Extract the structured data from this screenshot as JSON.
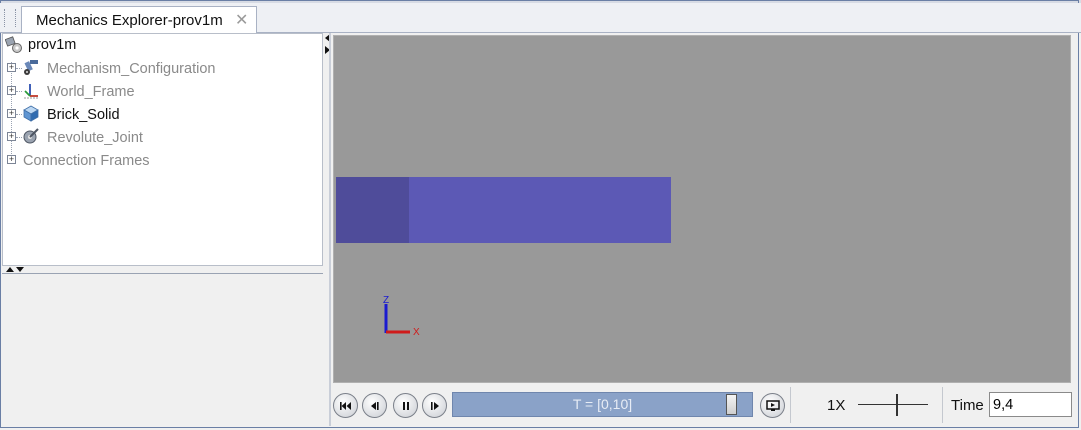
{
  "tab": {
    "title": "Mechanics Explorer-prov1m",
    "close_glyph": "✕"
  },
  "tree": {
    "root": "prov1m",
    "items": [
      {
        "label": "Mechanism_Configuration",
        "icon": "mechanism-configuration-icon",
        "enabled": false
      },
      {
        "label": "World_Frame",
        "icon": "world-frame-icon",
        "enabled": false
      },
      {
        "label": "Brick_Solid",
        "icon": "brick-solid-icon",
        "enabled": true
      },
      {
        "label": "Revolute_Joint",
        "icon": "revolute-joint-icon",
        "enabled": false
      },
      {
        "label": "Connection Frames",
        "icon": "",
        "enabled": false
      }
    ]
  },
  "viewport": {
    "background": "#999999",
    "brick_color": "#5c59b5",
    "brick_shadow_color": "#4f4c9a",
    "axis_z_label": "Z",
    "axis_x_label": "X"
  },
  "playback": {
    "buttons": [
      "skip-to-start-icon",
      "step-back-icon",
      "pause-icon",
      "step-forward-icon",
      "record-icon"
    ],
    "time_range_label": "T = [0,10]",
    "speed_label": "1X",
    "time_label": "Time",
    "time_value": "9,4"
  }
}
